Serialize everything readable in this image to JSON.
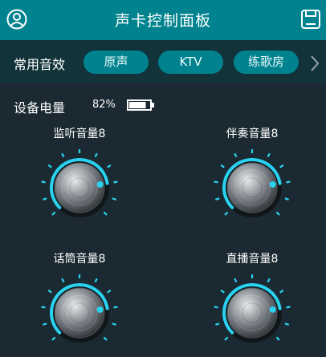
{
  "header": {
    "title": "声卡控制面板",
    "user_icon": "user-circle-icon",
    "save_icon": "save-icon"
  },
  "presets": {
    "label": "常用音效",
    "items": [
      "原声",
      "KTV",
      "练歌房"
    ],
    "more_icon": "chevron-right-icon"
  },
  "battery": {
    "label": "设备电量",
    "percent": "82%",
    "level": 0.82
  },
  "knobs": [
    {
      "label": "监听音量8",
      "level": 8
    },
    {
      "label": "伴奏音量8",
      "level": 8
    },
    {
      "label": "话筒音量8",
      "level": 8
    },
    {
      "label": "直播音量8",
      "level": 8
    }
  ],
  "colors": {
    "accent": "#00838f",
    "knob_ring": "#29d3f0",
    "background": "#1b2a32"
  }
}
